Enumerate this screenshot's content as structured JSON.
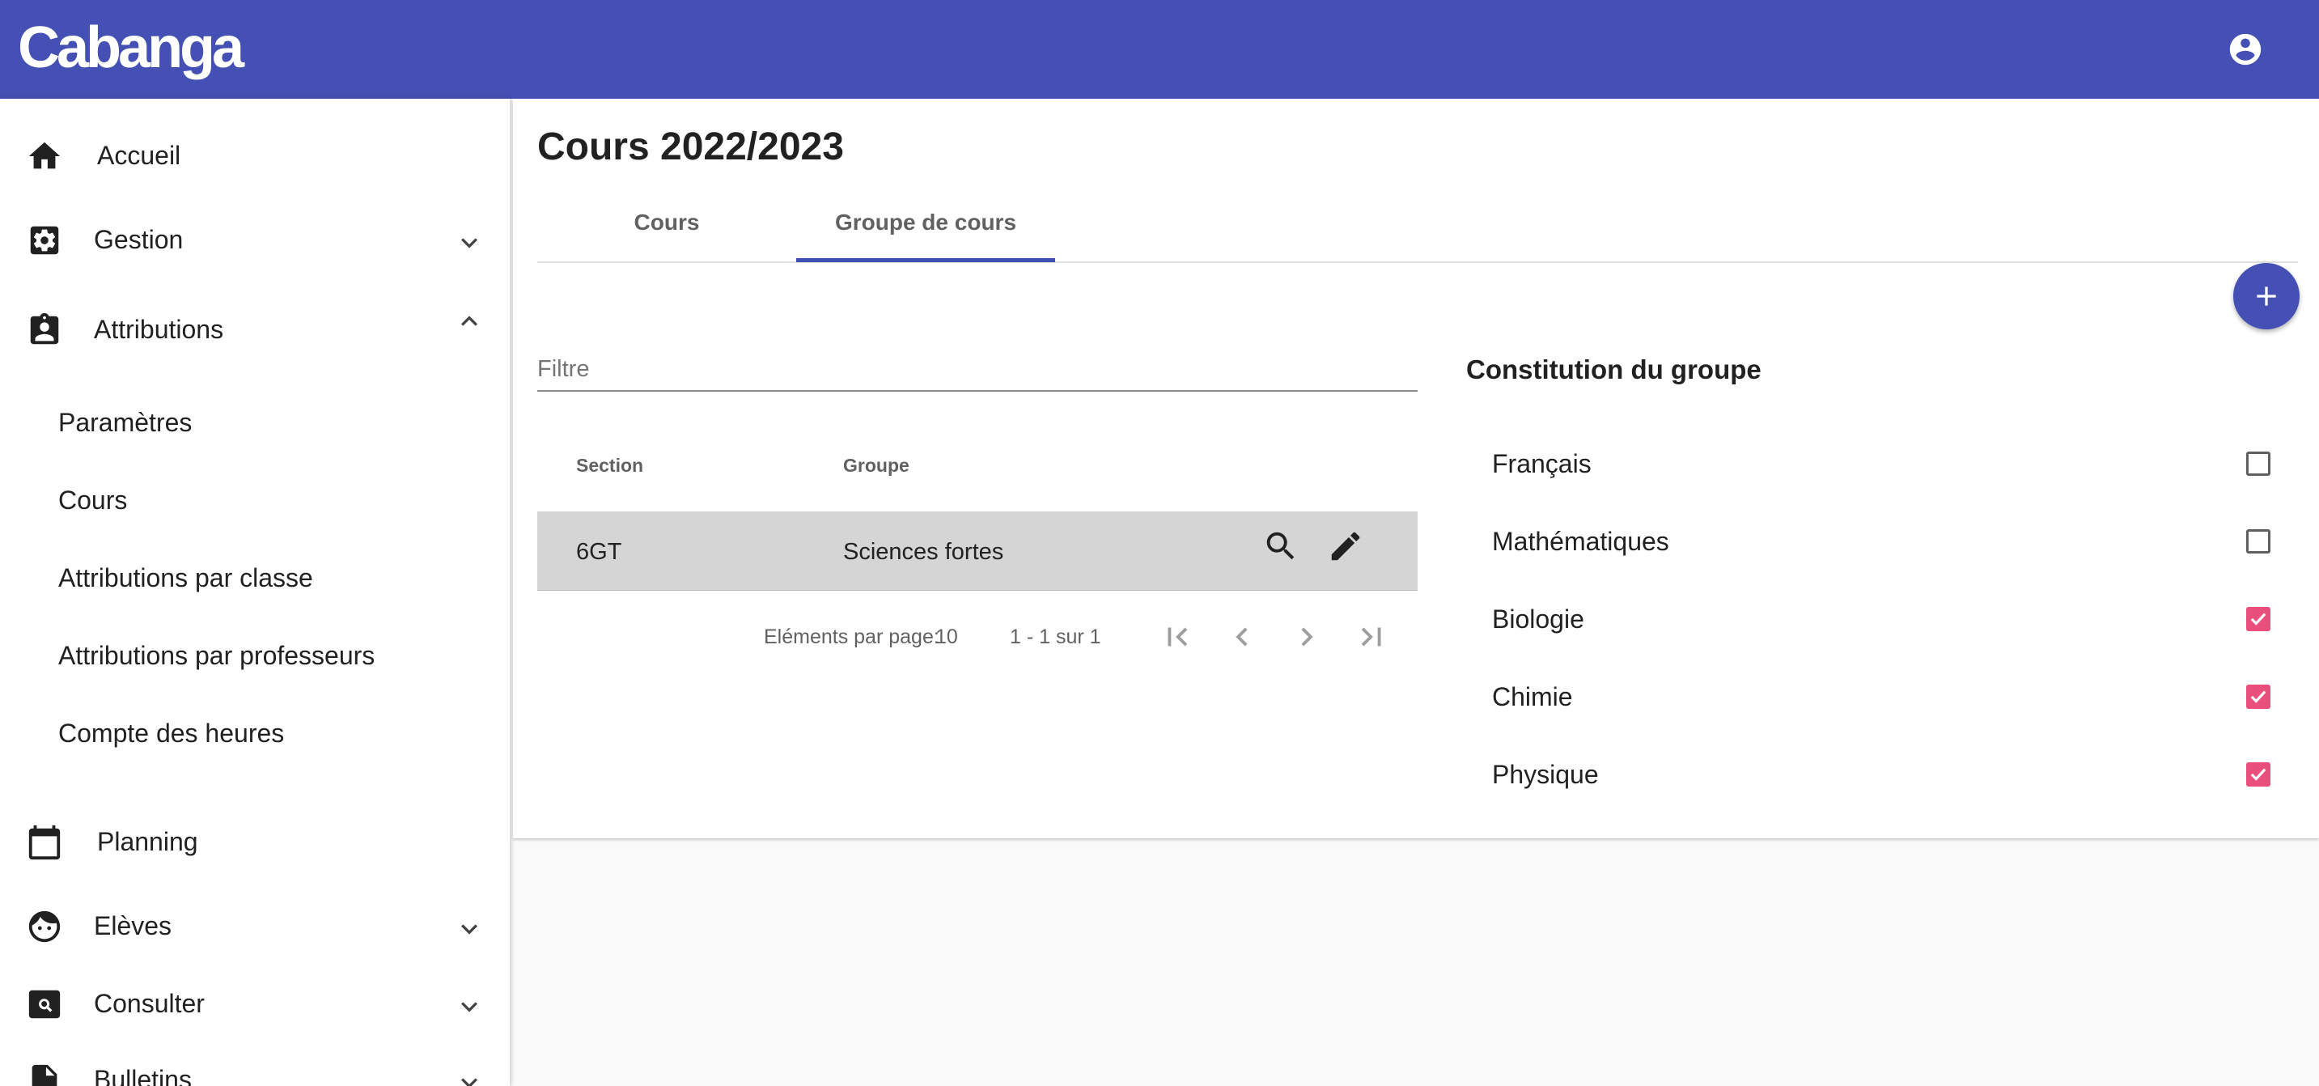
{
  "app": {
    "logo": "Cabanga"
  },
  "header": {
    "account_icon": "account-circle-icon"
  },
  "sidebar": {
    "items": [
      {
        "label": "Accueil",
        "icon": "home-icon"
      },
      {
        "label": "Gestion",
        "icon": "gear-box-icon",
        "expanded": false
      },
      {
        "label": "Attributions",
        "icon": "clipboard-account-icon",
        "expanded": true
      },
      {
        "label": "Planning",
        "icon": "calendar-icon"
      },
      {
        "label": "Elèves",
        "icon": "face-icon",
        "expanded": false
      },
      {
        "label": "Consulter",
        "icon": "search-box-icon",
        "expanded": false
      },
      {
        "label": "Bulletins",
        "icon": "file-icon",
        "expanded": false
      }
    ],
    "subitems": [
      "Paramètres",
      "Cours",
      "Attributions par classe",
      "Attributions par professeurs",
      "Compte des heures"
    ]
  },
  "main": {
    "title": "Cours 2022/2023",
    "tabs": [
      {
        "label": "Cours",
        "active": false
      },
      {
        "label": "Groupe de cours",
        "active": true
      }
    ],
    "filter": {
      "placeholder": "Filtre",
      "value": ""
    },
    "table": {
      "headers": [
        "Section",
        "Groupe"
      ],
      "rows": [
        {
          "section": "6GT",
          "groupe": "Sciences fortes"
        }
      ]
    },
    "paginator": {
      "items_per_page_label": "Eléments par page:",
      "items_per_page": "10",
      "range": "1 - 1 sur 1"
    }
  },
  "group": {
    "title": "Constitution du groupe",
    "options": [
      {
        "label": "Français",
        "checked": false
      },
      {
        "label": "Mathématiques",
        "checked": false
      },
      {
        "label": "Biologie",
        "checked": true
      },
      {
        "label": "Chimie",
        "checked": true
      },
      {
        "label": "Physique",
        "checked": true
      }
    ]
  },
  "colors": {
    "primary": "#4450b3",
    "accent": "#e94e7d",
    "row_highlight": "#d5d5d5"
  }
}
